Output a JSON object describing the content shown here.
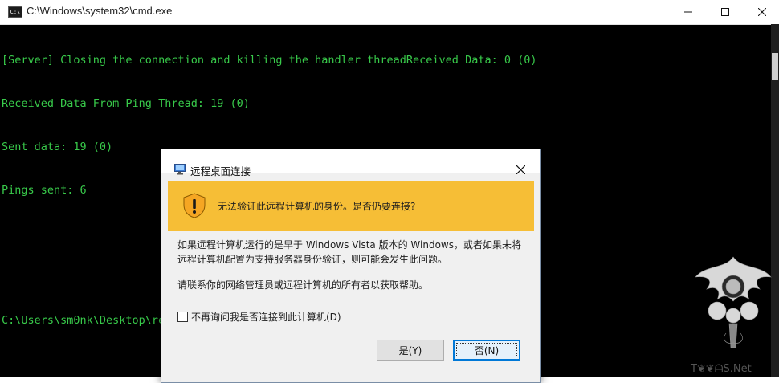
{
  "window": {
    "title": "C:\\Windows\\system32\\cmd.exe",
    "icon": "cmd-icon"
  },
  "console": {
    "lines": [
      "[Server] Closing the connection and killing the handler threadReceived Data: 0 (0)",
      "Received Data From Ping Thread: 19 (0)",
      "Sent data: 19 (0)",
      "Pings sent: 6",
      "",
      "",
      "C:\\Users\\sm0nk\\Desktop\\release>"
    ],
    "text_color": "#38c94a"
  },
  "dialog": {
    "title": "远程桌面连接",
    "banner_text": "无法验证此远程计算机的身份。是否仍要连接?",
    "body_line_1": "如果远程计算机运行的是早于 Windows Vista 版本的 Windows，或者如果未将",
    "body_line_2": "远程计算机配置为支持服务器身份验证，则可能会发生此问题。",
    "body_para_2": "请联系你的网络管理员或远程计算机的所有者以获取帮助。",
    "checkbox_label": "不再询问我是否连接到此计算机(D)",
    "checkbox_checked": false,
    "yes_label": "是(Y)",
    "no_label": "否(N)",
    "banner_color": "#f6be36"
  },
  "watermark": {
    "text": "T❦❦ᗩS.Net"
  }
}
